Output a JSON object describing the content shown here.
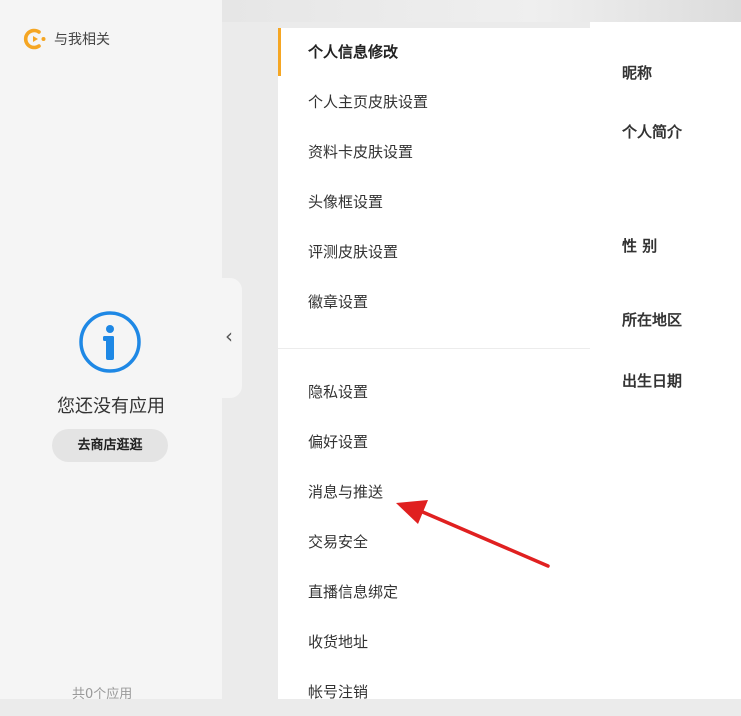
{
  "sidebar": {
    "brand_label": "与我相关",
    "empty_text": "您还没有应用",
    "store_button": "去商店逛逛",
    "app_count": "共0个应用",
    "collapse_glyph": "‹"
  },
  "menu": {
    "group1": [
      {
        "label": "个人信息修改",
        "active": true
      },
      {
        "label": "个人主页皮肤设置"
      },
      {
        "label": "资料卡皮肤设置"
      },
      {
        "label": "头像框设置"
      },
      {
        "label": "评测皮肤设置"
      },
      {
        "label": "徽章设置"
      }
    ],
    "group2": [
      {
        "label": "隐私设置"
      },
      {
        "label": "偏好设置"
      },
      {
        "label": "消息与推送"
      },
      {
        "label": "交易安全"
      },
      {
        "label": "直播信息绑定"
      },
      {
        "label": "收货地址"
      },
      {
        "label": "帐号注销"
      }
    ]
  },
  "form": {
    "fields": [
      "昵称",
      "个人简介",
      "性 别",
      "所在地区",
      "出生日期"
    ]
  },
  "colors": {
    "accent": "#f5a623",
    "icon_blue": "#1e88e5",
    "annotation_red": "#e02020"
  },
  "icons": {
    "brand": "brand-logo-icon",
    "empty_state": "info-icon",
    "collapse": "chevron-left-icon"
  }
}
